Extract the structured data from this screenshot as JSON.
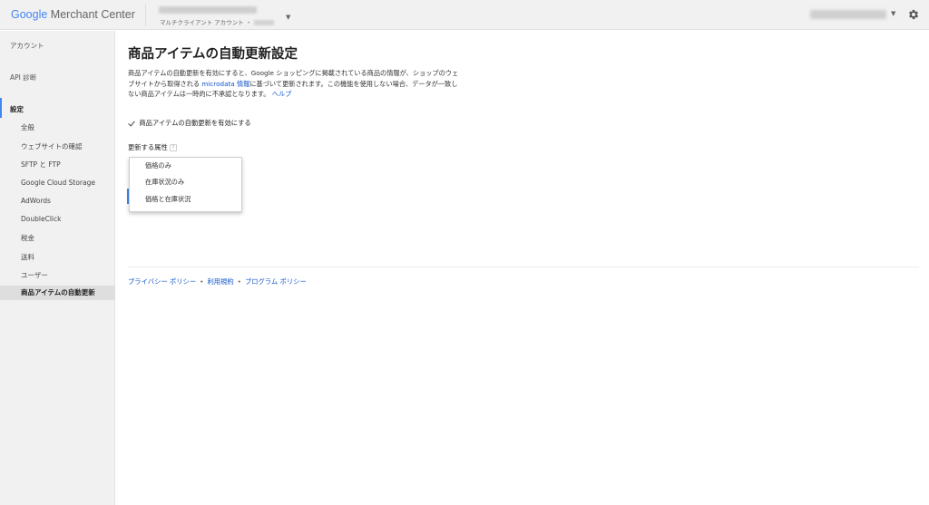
{
  "app": {
    "logo_google": "Google",
    "logo_product": "Merchant Center",
    "account_subtitle": "マルチクライアント アカウント ・"
  },
  "sidebar": {
    "items": [
      {
        "label": "アカウント"
      },
      {
        "label": "API 診断"
      },
      {
        "label": "設定"
      },
      {
        "label": "全般"
      },
      {
        "label": "ウェブサイトの確認"
      },
      {
        "label": "SFTP と FTP"
      },
      {
        "label": "Google Cloud Storage"
      },
      {
        "label": "AdWords"
      },
      {
        "label": "DoubleClick"
      },
      {
        "label": "税金"
      },
      {
        "label": "送料"
      },
      {
        "label": "ユーザー"
      },
      {
        "label": "商品アイテムの自動更新"
      }
    ]
  },
  "main": {
    "title": "商品アイテムの自動更新設定",
    "desc_part1": "商品アイテムの自動更新を有効にすると、Google ショッピングに掲載されている商品の情報が、ショップのウェブサイトから取得される ",
    "desc_link_microdata": "microdata 情報",
    "desc_part2": "に基づいて更新されます。この機能を使用しない場合、データが一致しない商品アイテムは一時的に不承認となります。 ",
    "desc_link_help": "ヘルプ",
    "checkbox_label": "商品アイテムの自動更新を有効にする",
    "checkbox_checked": true,
    "attr_label": "更新する属性",
    "help_mark": "?",
    "dropdown_options": [
      {
        "label": "価格のみ"
      },
      {
        "label": "在庫状況のみ"
      },
      {
        "label": "価格と在庫状況"
      }
    ]
  },
  "footer": {
    "privacy": "プライバシー ポリシー",
    "terms": "利用規約",
    "program": "プログラム ポリシー",
    "separator": "•"
  },
  "colors": {
    "accent": "#4285f4",
    "link": "#1155cc",
    "sidebar_bg": "#f1f1f1",
    "active_bg": "#dedede"
  }
}
